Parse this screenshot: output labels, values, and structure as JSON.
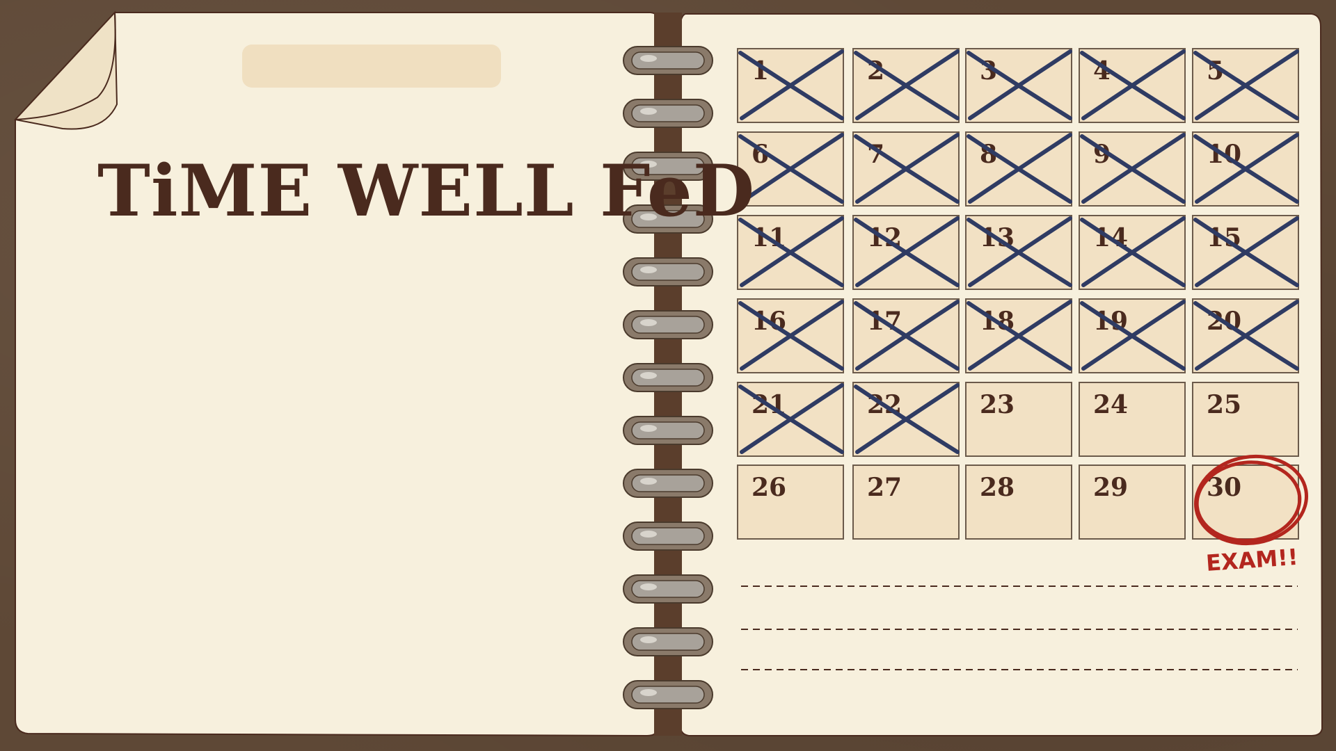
{
  "title": "TiME WELL FeD",
  "calendar": {
    "days": [
      "1",
      "2",
      "3",
      "4",
      "5",
      "6",
      "7",
      "8",
      "9",
      "10",
      "11",
      "12",
      "13",
      "14",
      "15",
      "16",
      "17",
      "18",
      "19",
      "20",
      "21",
      "22",
      "23",
      "24",
      "25",
      "26",
      "27",
      "28",
      "29",
      "30"
    ],
    "crossed_through": 22,
    "circled_day": "30",
    "circled_note": "EXAM!!"
  },
  "colors": {
    "background": "#5e4836",
    "paper": "#f7f0dd",
    "cell": "#f2e1c4",
    "ink": "#4a2a1e",
    "cross": "#2f3b63",
    "circle": "#b3261e"
  }
}
